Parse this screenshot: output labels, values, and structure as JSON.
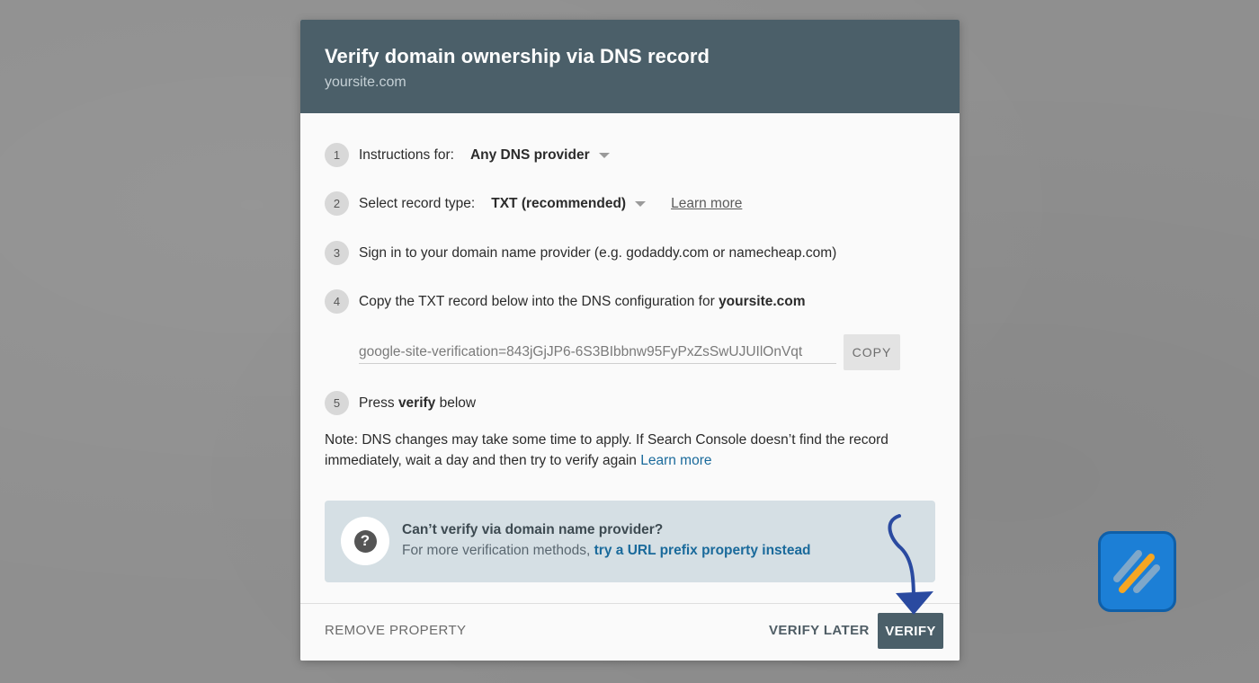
{
  "dialog": {
    "title": "Verify domain ownership via DNS record",
    "subtitle": "yoursite.com"
  },
  "steps": [
    {
      "num": "1",
      "label": "Instructions for:",
      "dropdown": "Any DNS provider"
    },
    {
      "num": "2",
      "label": "Select record type:",
      "dropdown": "TXT (recommended)",
      "link": "Learn more"
    },
    {
      "num": "3",
      "label": "Sign in to your domain name provider (e.g. godaddy.com or namecheap.com)"
    },
    {
      "num": "4",
      "label": "Copy the TXT record below into the DNS configuration for ",
      "bold": "yoursite.com"
    },
    {
      "num": "5",
      "label_pre": "Press ",
      "bold": "verify",
      "label_post": " below"
    }
  ],
  "record": {
    "value": "google-site-verification=843jGjJP6-6S3BIbbnw95FyPxZsSwUJUIlOnVqt",
    "copy_label": "COPY"
  },
  "note": {
    "text": "Note: DNS changes may take some time to apply. If Search Console doesn’t find the record immediately, wait a day and then try to verify again ",
    "link": "Learn more"
  },
  "info_box": {
    "title": "Can’t verify via domain name provider?",
    "text": "For more verification methods, ",
    "link": "try a URL prefix property instead",
    "icon": "help-icon"
  },
  "footer": {
    "remove_label": "REMOVE PROPERTY",
    "later_label": "VERIFY LATER",
    "verify_label": "VERIFY"
  },
  "colors": {
    "header_bg": "#4b5f69",
    "info_bg": "#d5dfe4",
    "link": "#1a6a9b",
    "arrow": "#2a4aa0",
    "logo_bg": "#1c7fd6",
    "logo_stripe": "#f5a623"
  }
}
